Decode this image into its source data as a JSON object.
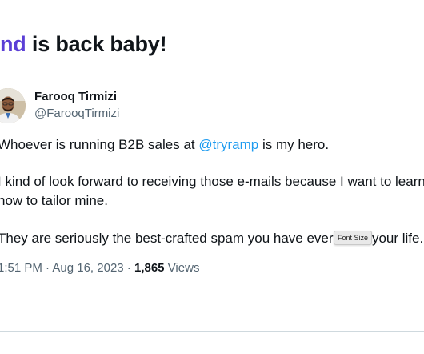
{
  "headline": {
    "accent": "nd",
    "rest": " is back baby!"
  },
  "colors": {
    "accent": "#5b3fd6",
    "mention": "#1d9bf0",
    "secondary_text": "#536471"
  },
  "tweet": {
    "author_name": "Farooq Tirmizi",
    "author_handle": "@FarooqTirmizi",
    "line1_pre": "Whoever is running B2B sales at ",
    "line1_mention": "@tryramp",
    "line1_post": " is my hero.",
    "line2": "I kind of look forward to receiving those e-mails because I want to learn",
    "line3": "how to tailor mine.",
    "line4_pre": "They are seriously the best-crafted spam you have ever r",
    "line4_post": "your life.",
    "time": "1:51 PM",
    "date": "Aug 16, 2023",
    "views_count": "1,865",
    "views_label": "Views"
  },
  "tooltip": {
    "label": "Font Size"
  },
  "icons": {
    "avatar": "profile-photo"
  }
}
